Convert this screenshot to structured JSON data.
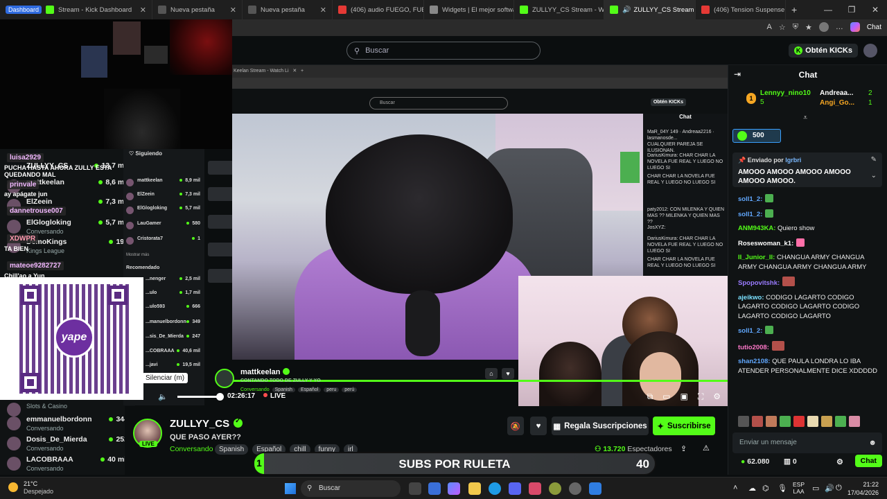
{
  "browser": {
    "tabs": [
      {
        "label": "Stream - Kick Dashboard",
        "pill": "Dashboard",
        "color": "#53fc18"
      },
      {
        "label": "Nueva pestaña",
        "color": "#555"
      },
      {
        "label": "Nueva pestaña",
        "color": "#555"
      },
      {
        "label": "(406) audio FUEGO, FUEGO",
        "color": "#e53935"
      },
      {
        "label": "Widgets | El mejor softwa",
        "color": "#888"
      },
      {
        "label": "ZULLYY_CS Stream - Watc",
        "color": "#53fc18"
      },
      {
        "label": "ZULLYY_CS Stream - W",
        "color": "#53fc18",
        "active": true
      },
      {
        "label": "(406) Tension Suspense Co",
        "color": "#e53935"
      }
    ],
    "new_tab": "+",
    "window_controls": [
      "—",
      "❐",
      "✕"
    ],
    "address_tools": [
      "A",
      "☆",
      "⛨",
      "★",
      "…"
    ],
    "chat_label": "Chat"
  },
  "header": {
    "search_placeholder": "Buscar",
    "kicks_button": "Obtén KICKs"
  },
  "overlay": {
    "chat_lines": [
      {
        "name": "luisa2929",
        "msg": "PUCHA HASTA AHORA ZULLY ESTA QUEDANDO MAL"
      },
      {
        "name": "prinvale",
        "msg": "ay apágate jun"
      },
      {
        "name": "dannetrouse007",
        "msg": ""
      },
      {
        "name": "XDWPR",
        "msg": "TA BIEN"
      },
      {
        "name": "mateoe9282727",
        "msg": "Chill'ao a Yun"
      }
    ],
    "qr_brand": "yape"
  },
  "side_following": [
    {
      "name": "ZULLYY_CS",
      "viewers": "13,7 mil",
      "sub": ""
    },
    {
      "name": "mattkeelan",
      "viewers": "8,6 mil",
      "sub": ""
    },
    {
      "name": "ElZeein",
      "viewers": "7,3 mil",
      "sub": ""
    },
    {
      "name": "ElGlogloking",
      "viewers": "5,7 mil",
      "sub": "Conversando"
    },
    {
      "name": "DemoKings",
      "viewers": "194",
      "sub": "Kings League"
    }
  ],
  "side_bottom": [
    {
      "name": "",
      "viewers": "",
      "sub": "Slots & Casino"
    },
    {
      "name": "emmanuelbordonn",
      "viewers": "344",
      "sub": "Conversando"
    },
    {
      "name": "Dosis_De_Mierda",
      "viewers": "252",
      "sub": "Conversando"
    },
    {
      "name": "LACOBRAAA",
      "viewers": "40 mil",
      "sub": "Conversando"
    }
  ],
  "nested": {
    "tab_label": "Keelan Stream - Watch Li",
    "search": "Buscar",
    "kicks": "Obtén KICKs",
    "chat_title": "Chat",
    "following_title": "Siguiendo",
    "recommended_title": "Recomendado",
    "show_more": "Mostrar más",
    "following": [
      {
        "name": "mattkeelan",
        "viewers": "8,9 mil"
      },
      {
        "name": "ElZeein",
        "viewers": "7,3 mil"
      },
      {
        "name": "ElGlogloking",
        "viewers": "5,7 mil"
      },
      {
        "name": "LauGamer",
        "viewers": "580"
      },
      {
        "name": "Cristorata7",
        "viewers": "1"
      }
    ],
    "recommended": [
      {
        "name": "...nenger",
        "viewers": "2,5 mil"
      },
      {
        "name": "...ulo",
        "viewers": "1,7 mil"
      },
      {
        "name": "...ulo593",
        "viewers": "666"
      },
      {
        "name": "...manuelbordonn",
        "viewers": "349"
      },
      {
        "name": "...sis_De_Mierda",
        "viewers": "247"
      },
      {
        "name": "...COBRAAA",
        "viewers": "40,6 mil"
      },
      {
        "name": "...javi",
        "viewers": "19,5 mil"
      }
    ],
    "chat_lines": [
      "MaR_04Y 149 · Andreaa2216 · lasmanosde...",
      "CUALQUIER PAREJA SE ILUSIONAN.",
      "DariusKimura: CHAR CHAR LA NOVELA FUE REAL Y LUEGO NO LUEGO SI",
      "CHAR CHAR LA NOVELA FUE REAL Y LUEGO NO LUEGO SI",
      "paty2012: CON MILENKA Y QUIEN MAS ?? MILENKA Y QUIEN MAS ??",
      "JosXYZ:",
      "DariusKimura: CHAR CHAR LA NOVELA FUE REAL Y LUEGO NO LUEGO SI",
      "CHAR CHAR LA NOVELA FUE REAL Y LUEGO NO LUEGO SI"
    ]
  },
  "player": {
    "mini_name": "mattkeelan",
    "mini_title": "CONTANDO TODO DE ZULLY Y YO",
    "mini_category": "Conversando",
    "mini_tags": [
      "Spanish",
      "Español",
      "peru",
      "perú"
    ],
    "tooltip": "Silenciar (m)",
    "time": "02:26:17",
    "live": "LIVE"
  },
  "info": {
    "live_badge": "LIVE",
    "name": "ZULLYY_CS",
    "title": "QUE PASO AYER??",
    "category": "Conversando",
    "tags": [
      "Spanish",
      "Español",
      "chill",
      "funny",
      "irl"
    ],
    "viewers_count": "13.720",
    "viewers_label": "Espectadores",
    "gift_button": "Regala Suscripciones",
    "subscribe_button": "Suscribirse",
    "share_icon": "share-icon",
    "warn_icon": "warning-icon"
  },
  "ruleta": {
    "label": "SUBS POR RULETA",
    "count": "40",
    "start": "1"
  },
  "chat": {
    "title": "Chat",
    "leader1": {
      "rank": "1",
      "name": "Lennyy_nino10",
      "count": "5"
    },
    "leader2": {
      "name": "Andreaa...",
      "count": "2"
    },
    "leader3": {
      "name": "Angi_Go...",
      "count": "1"
    },
    "kick_amount": "500",
    "pinned_by_label": "Enviado por",
    "pinned_by": "lgrbri",
    "pinned_text": "AMOOO AMOOO AMOOO AMOOO AMOOO AMOOO.",
    "messages": [
      {
        "user": "soll1_2:",
        "color": "c-blue",
        "text": ""
      },
      {
        "user": "soll1_2:",
        "color": "c-blue",
        "text": ""
      },
      {
        "user": "ANM943KA:",
        "color": "c-green",
        "text": "Quiero show"
      },
      {
        "user": "Roseswoman_k1:",
        "color": "c-pink",
        "text": ""
      },
      {
        "user": "II_Junior_II:",
        "color": "c-green",
        "text": "CHANGUA ARMY CHANGUA ARMY CHANGUA ARMY CHANGUA ARMY"
      },
      {
        "user": "Spopovitshk:",
        "color": "c-pink",
        "text": ""
      },
      {
        "user": "ajeikwo:",
        "color": "c-cyan",
        "text": "CODIGO LAGARTO CODIGO LAGARTO CODIGO LAGARTO CODIGO LAGARTO CODIGO LAGARTO"
      },
      {
        "user": "soll1_2:",
        "color": "c-blue",
        "text": ""
      },
      {
        "user": "tutio2008:",
        "color": "c-pink",
        "text": ""
      },
      {
        "user": "shan2108:",
        "color": "c-blue",
        "text": "QUE PAULA LONDRA LO IBA ATENDER PERSONALMENTE DICE XDDDDD"
      }
    ],
    "input_placeholder": "Enviar un mensaje",
    "kicks_balance": "62.080",
    "gifts": "0",
    "send_button": "Chat"
  },
  "taskbar": {
    "temp": "21°C",
    "weather": "Despejado",
    "search": "Buscar",
    "lang": "ESP",
    "lang2": "LAA",
    "time": "21:22",
    "date": "17/04/2026"
  }
}
